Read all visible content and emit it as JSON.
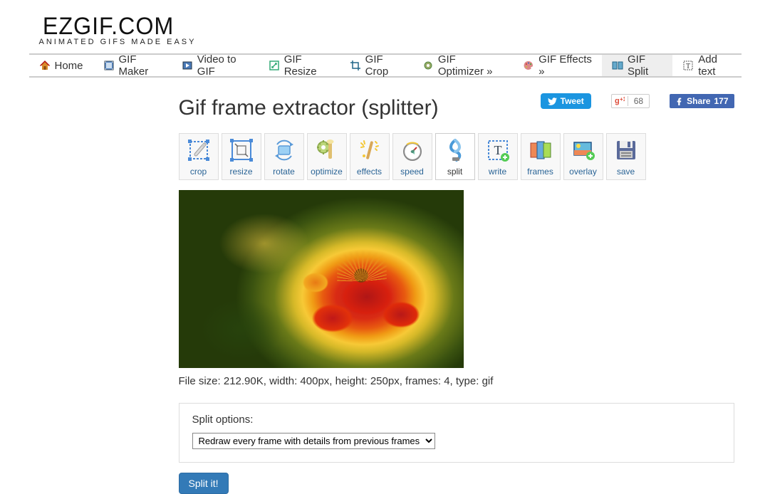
{
  "logo": {
    "text": "EZGIF.COM",
    "subtitle": "ANIMATED GIFS MADE EASY"
  },
  "nav": {
    "items": [
      {
        "label": "Home"
      },
      {
        "label": "GIF Maker"
      },
      {
        "label": "Video to GIF"
      },
      {
        "label": "GIF Resize"
      },
      {
        "label": "GIF Crop"
      },
      {
        "label": "GIF Optimizer »"
      },
      {
        "label": "GIF Effects »"
      },
      {
        "label": "GIF Split"
      },
      {
        "label": "Add text"
      }
    ],
    "active_index": 7
  },
  "page_title": "Gif frame extractor (splitter)",
  "social": {
    "tweet": "Tweet",
    "gplus_label": "+1",
    "gplus_count": "68",
    "fb_label": "Share",
    "fb_count": "177"
  },
  "tools": {
    "items": [
      {
        "label": "crop"
      },
      {
        "label": "resize"
      },
      {
        "label": "rotate"
      },
      {
        "label": "optimize"
      },
      {
        "label": "effects"
      },
      {
        "label": "speed"
      },
      {
        "label": "split"
      },
      {
        "label": "write"
      },
      {
        "label": "frames"
      },
      {
        "label": "overlay"
      },
      {
        "label": "save"
      }
    ],
    "active_index": 6
  },
  "file_meta": "File size: 212.90K, width: 400px, height: 250px, frames: 4, type: gif",
  "panel": {
    "title": "Split options:",
    "selected": "Redraw every frame with details from previous frames"
  },
  "action_button": "Split it!"
}
